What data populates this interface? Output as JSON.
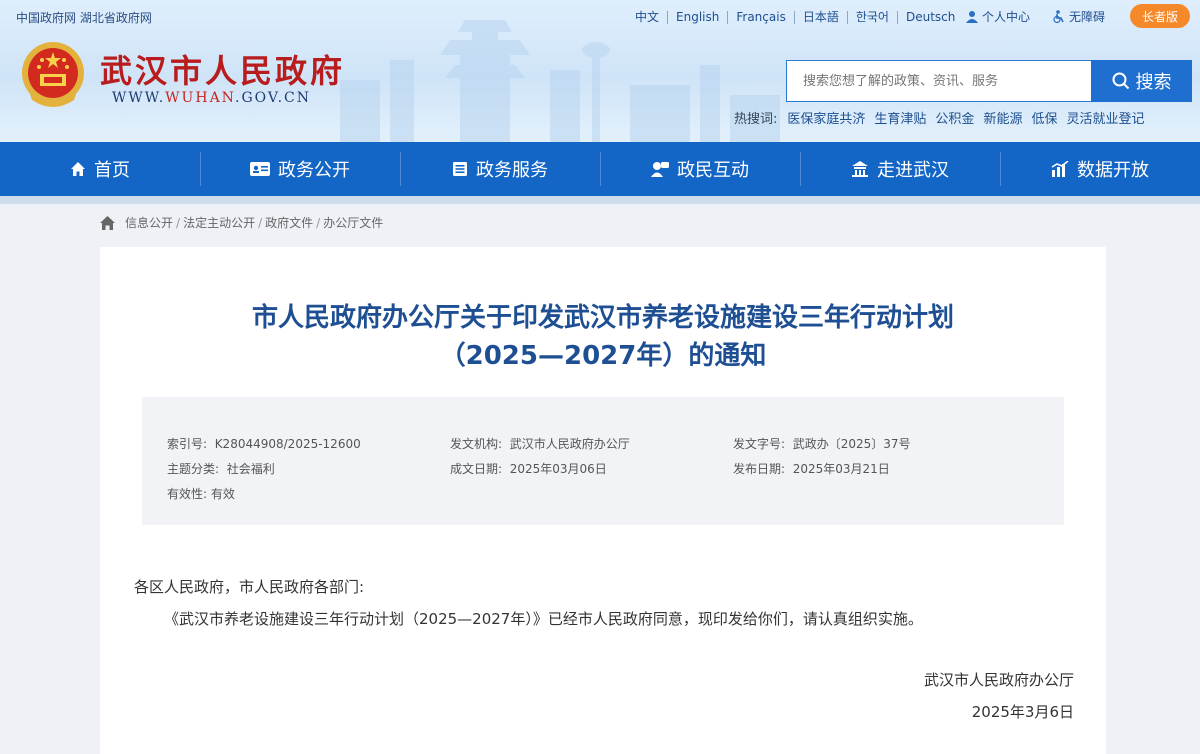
{
  "top": {
    "links": [
      "中国政府网",
      "湖北省政府网"
    ],
    "languages": [
      "中文",
      "English",
      "Français",
      "日本語",
      "한국어",
      "Deutsch"
    ],
    "personal_center": "个人中心",
    "accessibility": "无障碍",
    "elder_mode": "长者版"
  },
  "brand": {
    "name": "武汉市人民政府",
    "url_prefix": "WWW.",
    "url_highlight": "WUHAN",
    "url_suffix": ".GOV.CN"
  },
  "search": {
    "placeholder": "搜索您想了解的政策、资讯、服务",
    "button_label": "搜索",
    "hot_label": "热搜词:",
    "hot_terms": [
      "医保家庭共济",
      "生育津贴",
      "公积金",
      "新能源",
      "低保",
      "灵活就业登记"
    ]
  },
  "nav": {
    "items": [
      {
        "label": "首页",
        "icon": "home-icon"
      },
      {
        "label": "政务公开",
        "icon": "id-card-icon"
      },
      {
        "label": "政务服务",
        "icon": "briefcase-icon"
      },
      {
        "label": "政民互动",
        "icon": "chat-icon"
      },
      {
        "label": "走进武汉",
        "icon": "building-icon"
      },
      {
        "label": "数据开放",
        "icon": "chart-icon"
      }
    ]
  },
  "breadcrumb": [
    "信息公开",
    "法定主动公开",
    "政府文件",
    "办公厅文件"
  ],
  "article": {
    "title_line1": "市人民政府办公厅关于印发武汉市养老设施建设三年行动计划",
    "title_line2": "（2025—2027年）的通知",
    "meta": {
      "index_no_label": "索引号:",
      "index_no": "K28044908/2025-12600",
      "issuer_label": "发文机构:",
      "issuer": "武汉市人民政府办公厅",
      "doc_no_label": "发文字号:",
      "doc_no": "武政办〔2025〕37号",
      "topic_label": "主题分类:",
      "topic": "社会福利",
      "created_label": "成文日期:",
      "created": "2025年03月06日",
      "published_label": "发布日期:",
      "published": "2025年03月21日",
      "validity_label": "有效性:",
      "validity": "有效"
    },
    "salutation": "各区人民政府，市人民政府各部门:",
    "body": "《武汉市养老设施建设三年行动计划（2025—2027年）》已经市人民政府同意，现印发给你们，请认真组织实施。",
    "signature": "武汉市人民政府办公厅",
    "date": "2025年3月6日"
  },
  "colors": {
    "nav_bg": "#1466c6",
    "title": "#1f4f93",
    "brand_red": "#b81c1c",
    "elder_btn": "#f5892a"
  }
}
